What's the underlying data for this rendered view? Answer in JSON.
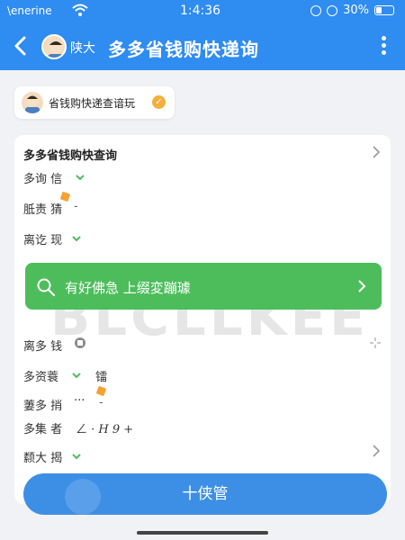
{
  "status_bar": {
    "carrier": "\\enerine",
    "time": "1:4:36",
    "battery": "30%",
    "battery_level": 0.3
  },
  "nav": {
    "back_icon": "chevron-left-icon",
    "user_name": "陕大",
    "title": "多多省钱购快递询",
    "more_icon": "more-vertical-icon"
  },
  "chip": {
    "label": "省钱购快递查谙玩"
  },
  "card": {
    "header": "多多省钱购快查询",
    "watermark": "BLCLLKEE",
    "rows": [
      {
        "label": "多询 信"
      },
      {
        "label": "胝责 猜"
      },
      {
        "label": "离讫 现"
      }
    ],
    "search_placeholder": "有好佛急 上缀変蹦璩",
    "rows2": [
      {
        "label": "离多 钱"
      },
      {
        "label": "多资蓑",
        "value": "镭"
      },
      {
        "label": "萋多 捎",
        "value": "···"
      },
      {
        "label": "多集 者",
        "value": "ㄥ · H  9 +"
      },
      {
        "label": "颣大 揭"
      }
    ]
  },
  "button": {
    "label": "十侠管"
  },
  "colors": {
    "primary": "#2f8cf0",
    "accent_green": "#4dbd5c",
    "check_orange": "#f2b03a",
    "button_blue": "#3d8fe6"
  }
}
